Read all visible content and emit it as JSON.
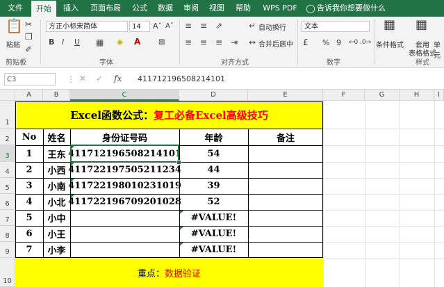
{
  "ribbon_tabs": [
    {
      "label": "文件"
    },
    {
      "label": "开始"
    },
    {
      "label": "插入"
    },
    {
      "label": "页面布局"
    },
    {
      "label": "公式"
    },
    {
      "label": "数据"
    },
    {
      "label": "审阅"
    },
    {
      "label": "视图"
    },
    {
      "label": "帮助"
    },
    {
      "label": "WPS PDF"
    },
    {
      "label": "告诉我你想要做什么"
    }
  ],
  "ribbon": {
    "paste_label": "粘贴",
    "font_name": "方正小标宋简体",
    "font_size": "14",
    "bold": "B",
    "italic": "I",
    "underline": "U",
    "wrap_text": "自动换行",
    "merge_center": "合并后居中",
    "number_format": "文本",
    "percent": "%",
    "comma": "9",
    "conditional_format": "条件格式",
    "table_format_line1": "套用",
    "table_format_line2": "表格格式",
    "cell_style": "单元",
    "groups": {
      "clipboard": "剪贴板",
      "font": "字体",
      "alignment": "对齐方式",
      "number": "数字",
      "styles": "样式"
    }
  },
  "formula_bar": {
    "name_box": "C3",
    "fx": "fx",
    "value": "411712196508214101"
  },
  "columns": [
    "A",
    "B",
    "C",
    "D",
    "E",
    "F",
    "G",
    "H",
    "I"
  ],
  "rows": [
    "1",
    "2",
    "3",
    "4",
    "5",
    "6",
    "7",
    "8",
    "9",
    "10"
  ],
  "sheet": {
    "title_black": "Excel函数公式：",
    "title_red": "复工必备Excel高级技巧",
    "headers": {
      "no": "No",
      "name": "姓名",
      "id": "身份证号码",
      "age": "年龄",
      "note": "备注"
    },
    "records": [
      {
        "no": "1",
        "name": "王东",
        "id": "411712196508214101",
        "age": "54"
      },
      {
        "no": "2",
        "name": "小西",
        "id": "411722197505211234",
        "age": "44"
      },
      {
        "no": "3",
        "name": "小南",
        "id": "411722198010231019",
        "age": "39"
      },
      {
        "no": "4",
        "name": "小北",
        "id": "411722196709201028",
        "age": "52"
      },
      {
        "no": "5",
        "name": "小中",
        "id": "",
        "age": "#VALUE!"
      },
      {
        "no": "6",
        "name": "小王",
        "id": "",
        "age": "#VALUE!"
      },
      {
        "no": "7",
        "name": "小李",
        "id": "",
        "age": "#VALUE!"
      }
    ],
    "footer_label": "重点：",
    "footer_value": "数据验证"
  },
  "colors": {
    "excel_green": "#217346",
    "title_red": "#ff0000",
    "highlight_yellow": "#ffff00"
  }
}
